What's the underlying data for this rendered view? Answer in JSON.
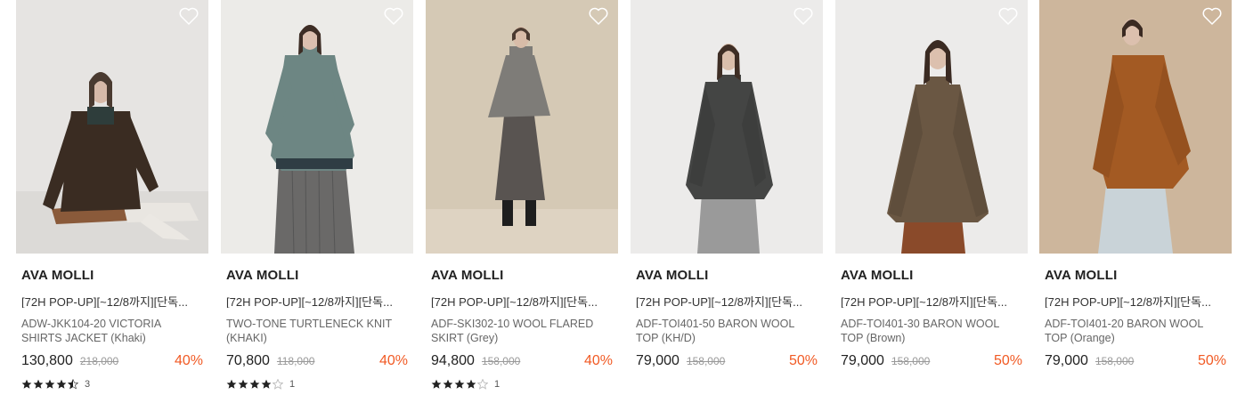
{
  "products": [
    {
      "brand": "AVA MOLLI",
      "promo": "[72H POP-UP][~12/8까지][단독...",
      "name": "ADW-JKK104-20 VICTORIA SHIRTS JACKET (Khaki)",
      "price": "130,800",
      "original_price": "218,000",
      "discount": "40%",
      "rating_stars": 4.5,
      "review_count": "3",
      "bg_color": "#e6e4e2",
      "garment_color": "#3a2c22"
    },
    {
      "brand": "AVA MOLLI",
      "promo": "[72H POP-UP][~12/8까지][단독...",
      "name": "TWO-TONE TURTLENECK KNIT (KHAKI)",
      "price": "70,800",
      "original_price": "118,000",
      "discount": "40%",
      "rating_stars": 4,
      "review_count": "1",
      "bg_color": "#ecebe8",
      "garment_color": "#6d8683"
    },
    {
      "brand": "AVA MOLLI",
      "promo": "[72H POP-UP][~12/8까지][단독...",
      "name": "ADF-SKI302-10 WOOL FLARED SKIRT (Grey)",
      "price": "94,800",
      "original_price": "158,000",
      "discount": "40%",
      "rating_stars": 4,
      "review_count": "1",
      "bg_color": "#d5c9b5",
      "garment_color": "#595451"
    },
    {
      "brand": "AVA MOLLI",
      "promo": "[72H POP-UP][~12/8까지][단독...",
      "name": "ADF-TOI401-50 BARON WOOL TOP (KH/D)",
      "price": "79,000",
      "original_price": "158,000",
      "discount": "50%",
      "rating_stars": null,
      "review_count": "",
      "bg_color": "#ecebea",
      "garment_color": "#444544"
    },
    {
      "brand": "AVA MOLLI",
      "promo": "[72H POP-UP][~12/8까지][단독...",
      "name": "ADF-TOI401-30 BARON WOOL TOP (Brown)",
      "price": "79,000",
      "original_price": "158,000",
      "discount": "50%",
      "rating_stars": null,
      "review_count": "",
      "bg_color": "#ecebea",
      "garment_color": "#6a5743"
    },
    {
      "brand": "AVA MOLLI",
      "promo": "[72H POP-UP][~12/8까지][단독...",
      "name": "ADF-TOI401-20 BARON WOOL TOP (Orange)",
      "price": "79,000",
      "original_price": "158,000",
      "discount": "50%",
      "rating_stars": null,
      "review_count": "",
      "bg_color": "#cdb69c",
      "garment_color": "#a35a23"
    }
  ],
  "colors": {
    "discount": "#f15a24",
    "price": "#222222",
    "original_price": "#999999",
    "star": "#222222"
  },
  "icons": {
    "wishlist": "heart-outline-icon",
    "rating": "star-icon"
  }
}
